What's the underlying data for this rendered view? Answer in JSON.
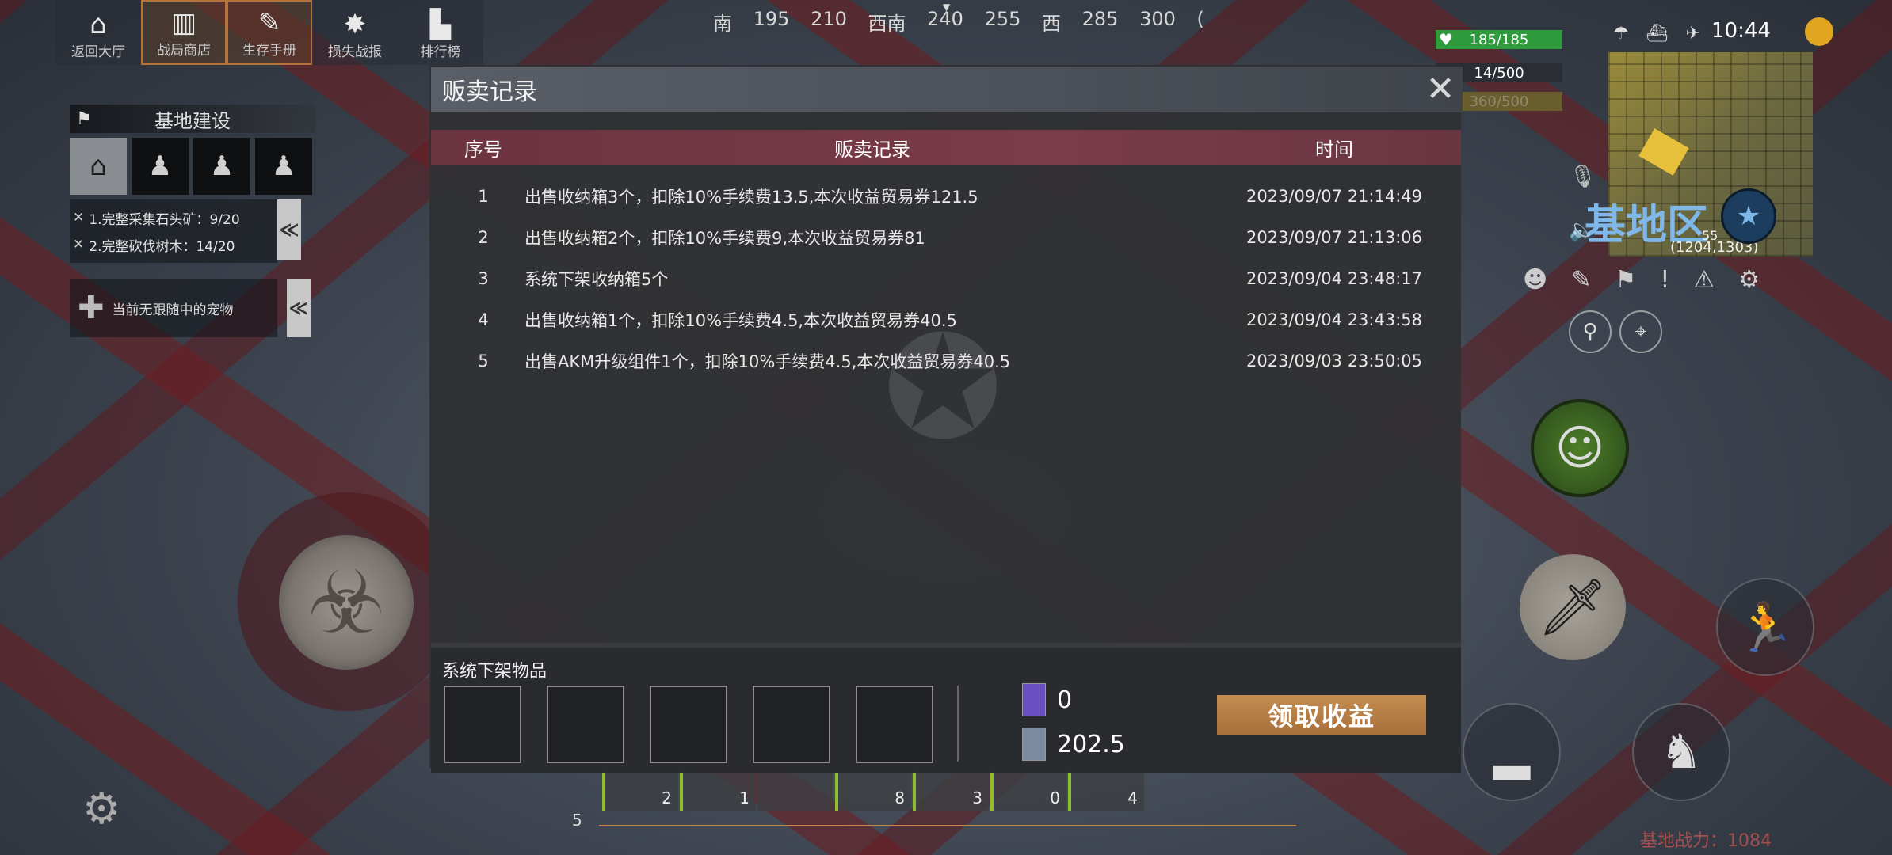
{
  "topnav": [
    {
      "label": "返回大厅",
      "icon": "home-icon",
      "glyph": "⌂"
    },
    {
      "label": "战局商店",
      "icon": "shop-icon",
      "glyph": "▥"
    },
    {
      "label": "生存手册",
      "icon": "handbook-icon",
      "glyph": "✎"
    },
    {
      "label": "损失战报",
      "icon": "loss-report-icon",
      "glyph": "✸"
    },
    {
      "label": "排行榜",
      "icon": "leaderboard-icon",
      "glyph": "▙"
    }
  ],
  "compass": [
    "南",
    "195",
    "210",
    "西南",
    "240",
    "255",
    "西",
    "285",
    "300",
    "("
  ],
  "base_panel": {
    "title": "基地建设",
    "tasks": [
      "1.完整采集石头矿：9/20",
      "2.完整砍伐树木：14/20"
    ],
    "pet_text": "当前无跟随中的宠物",
    "collapse_glyph": "≪"
  },
  "hud": {
    "health": "185/185",
    "stat2": "14/500",
    "stat3": "360/500",
    "time": "10:44",
    "region": "基地区",
    "zone_num": "55",
    "coords": "(1204,1303)",
    "base_power": "基地战力：1084"
  },
  "dialog": {
    "title": "贩卖记录",
    "close_glyph": "✕",
    "columns": {
      "index": "序号",
      "record": "贩卖记录",
      "time": "时间"
    },
    "rows": [
      {
        "index": "1",
        "record": "出售收纳箱3个，扣除10%手续费13.5,本次收益贸易券121.5",
        "time": "2023/09/07 21:14:49"
      },
      {
        "index": "2",
        "record": "出售收纳箱2个，扣除10%手续费9,本次收益贸易券81",
        "time": "2023/09/07 21:13:06"
      },
      {
        "index": "3",
        "record": "系统下架收纳箱5个",
        "time": "2023/09/04 23:48:17"
      },
      {
        "index": "4",
        "record": "出售收纳箱1个，扣除10%手续费4.5,本次收益贸易券40.5",
        "time": "2023/09/04 23:43:58"
      },
      {
        "index": "5",
        "record": "出售AKM升级组件1个，扣除10%手续费4.5,本次收益贸易券40.5",
        "time": "2023/09/03 23:50:05"
      }
    ],
    "removed_items_label": "系统下架物品",
    "currency": [
      {
        "icon": "purple-card-icon",
        "value": "0",
        "color": "#6a4fc0"
      },
      {
        "icon": "trade-ticket-icon",
        "value": "202.5",
        "color": "#7b8aa0"
      }
    ],
    "claim_button": "领取收益"
  },
  "hotbar": {
    "counts": [
      "2",
      "1",
      "",
      "8",
      "3",
      "0",
      "4"
    ],
    "left_num": "5"
  },
  "colors": {
    "accent": "#a8703a",
    "header_row": "#7a3c48",
    "health": "#2e9a3c"
  }
}
